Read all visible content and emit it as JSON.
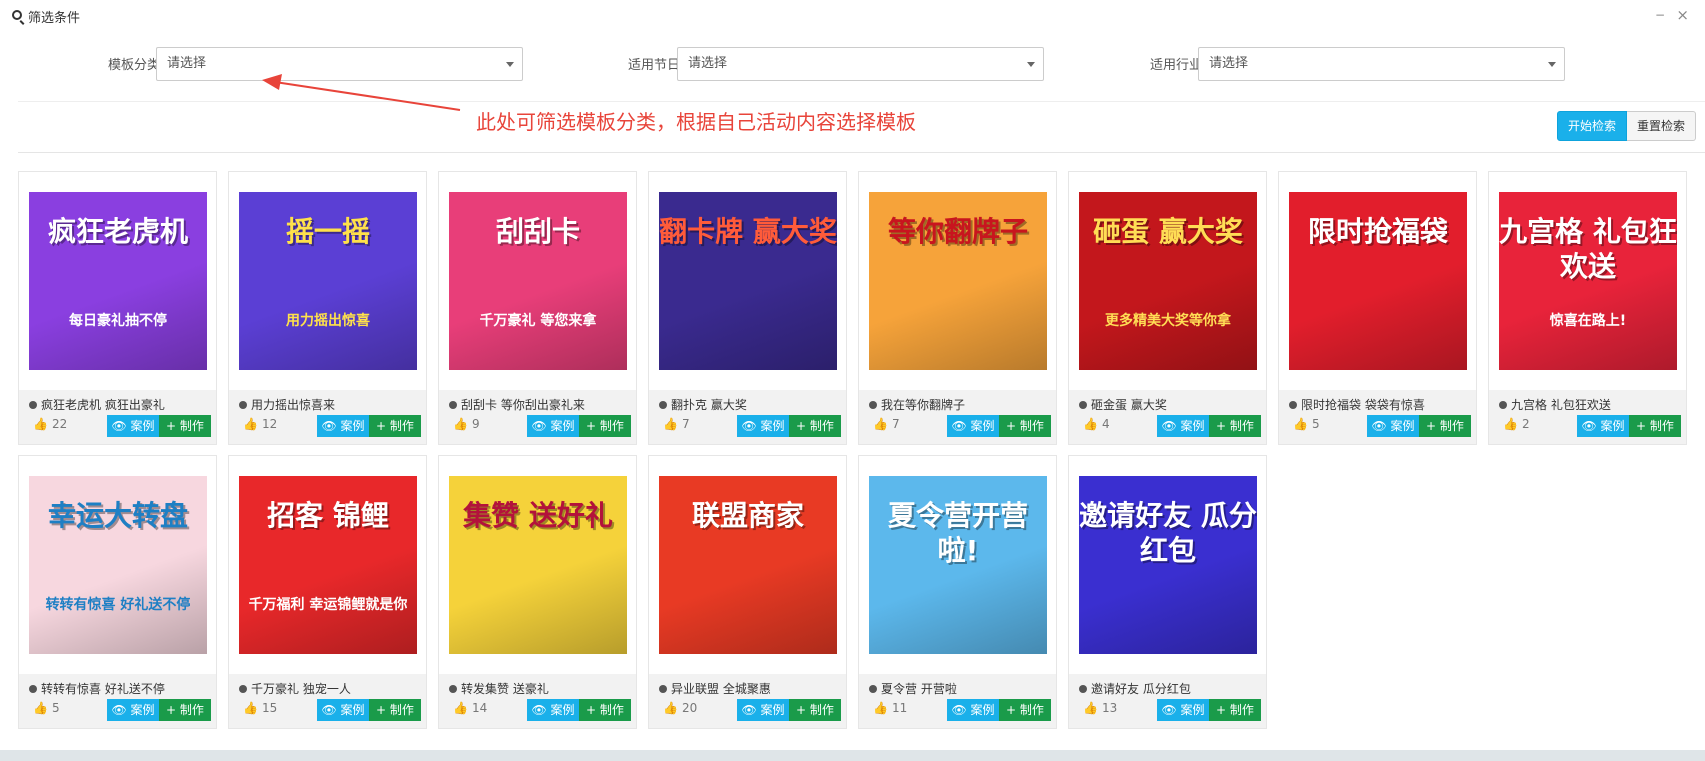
{
  "panel": {
    "title": "筛选条件",
    "minimize": "−",
    "close": "×"
  },
  "filters": {
    "category": {
      "label": "模板分类",
      "value": "请选择"
    },
    "holiday": {
      "label": "适用节日",
      "value": "请选择"
    },
    "industry": {
      "label": "适用行业",
      "value": "请选择"
    }
  },
  "annotation": "此处可筛选模板分类，根据自己活动内容选择模板",
  "search_label": "开始检索",
  "reset_label": "重置检索",
  "case_label": "案例",
  "make_label": "制作",
  "cards": [
    {
      "title": "疯狂老虎机 疯狂出豪礼",
      "likes": "22",
      "img_title": "疯狂老虎机",
      "img_sub": "每日豪礼抽不停",
      "bg": "#8a3fe0",
      "fg": "#ffffff"
    },
    {
      "title": "用力摇出惊喜来",
      "likes": "12",
      "img_title": "摇一摇",
      "img_sub": "用力摇出惊喜",
      "bg": "#5b3fd4",
      "fg": "#ffe14a"
    },
    {
      "title": "刮刮卡 等你刮出豪礼来",
      "likes": "9",
      "img_title": "刮刮卡",
      "img_sub": "千万豪礼 等您来拿",
      "bg": "#e83e79",
      "fg": "#ffffff"
    },
    {
      "title": "翻扑克 赢大奖",
      "likes": "7",
      "img_title": "翻卡牌 赢大奖",
      "img_sub": "",
      "bg": "#3a2a8f",
      "fg": "#ff5b3a"
    },
    {
      "title": "我在等你翻牌子",
      "likes": "7",
      "img_title": "等你翻牌子",
      "img_sub": "",
      "bg": "#f6a33a",
      "fg": "#c8151e"
    },
    {
      "title": "砸金蛋 赢大奖",
      "likes": "4",
      "img_title": "砸蛋 赢大奖",
      "img_sub": "更多精美大奖等你拿",
      "bg": "#c3171c",
      "fg": "#ffdd55"
    },
    {
      "title": "限时抢福袋 袋袋有惊喜",
      "likes": "5",
      "img_title": "限时抢福袋",
      "img_sub": "",
      "bg": "#e21e2c",
      "fg": "#ffffff"
    },
    {
      "title": "九宫格 礼包狂欢送",
      "likes": "2",
      "img_title": "九宫格 礼包狂欢送",
      "img_sub": "惊喜在路上!",
      "bg": "#e8233a",
      "fg": "#ffffff"
    },
    {
      "title": "转转有惊喜 好礼送不停",
      "likes": "5",
      "img_title": "幸运大转盘",
      "img_sub": "转转有惊喜 好礼送不停",
      "bg": "#f7d7df",
      "fg": "#1e7fc4"
    },
    {
      "title": "千万豪礼 独宠一人",
      "likes": "15",
      "img_title": "招客 锦鲤",
      "img_sub": "千万福利 幸运锦鲤就是你",
      "bg": "#e8282a",
      "fg": "#ffffff"
    },
    {
      "title": "转发集赞 送豪礼",
      "likes": "14",
      "img_title": "集赞 送好礼",
      "img_sub": "",
      "bg": "#f5d23a",
      "fg": "#b3123b"
    },
    {
      "title": "异业联盟 全城聚惠",
      "likes": "20",
      "img_title": "联盟商家",
      "img_sub": "",
      "bg": "#e83a24",
      "fg": "#ffffff"
    },
    {
      "title": "夏令营 开营啦",
      "likes": "11",
      "img_title": "夏令营开营啦!",
      "img_sub": "",
      "bg": "#5cb8ec",
      "fg": "#ffffff"
    },
    {
      "title": "邀请好友 瓜分红包",
      "likes": "13",
      "img_title": "邀请好友 瓜分红包",
      "img_sub": "",
      "bg": "#3a2fd0",
      "fg": "#ffffff"
    }
  ]
}
